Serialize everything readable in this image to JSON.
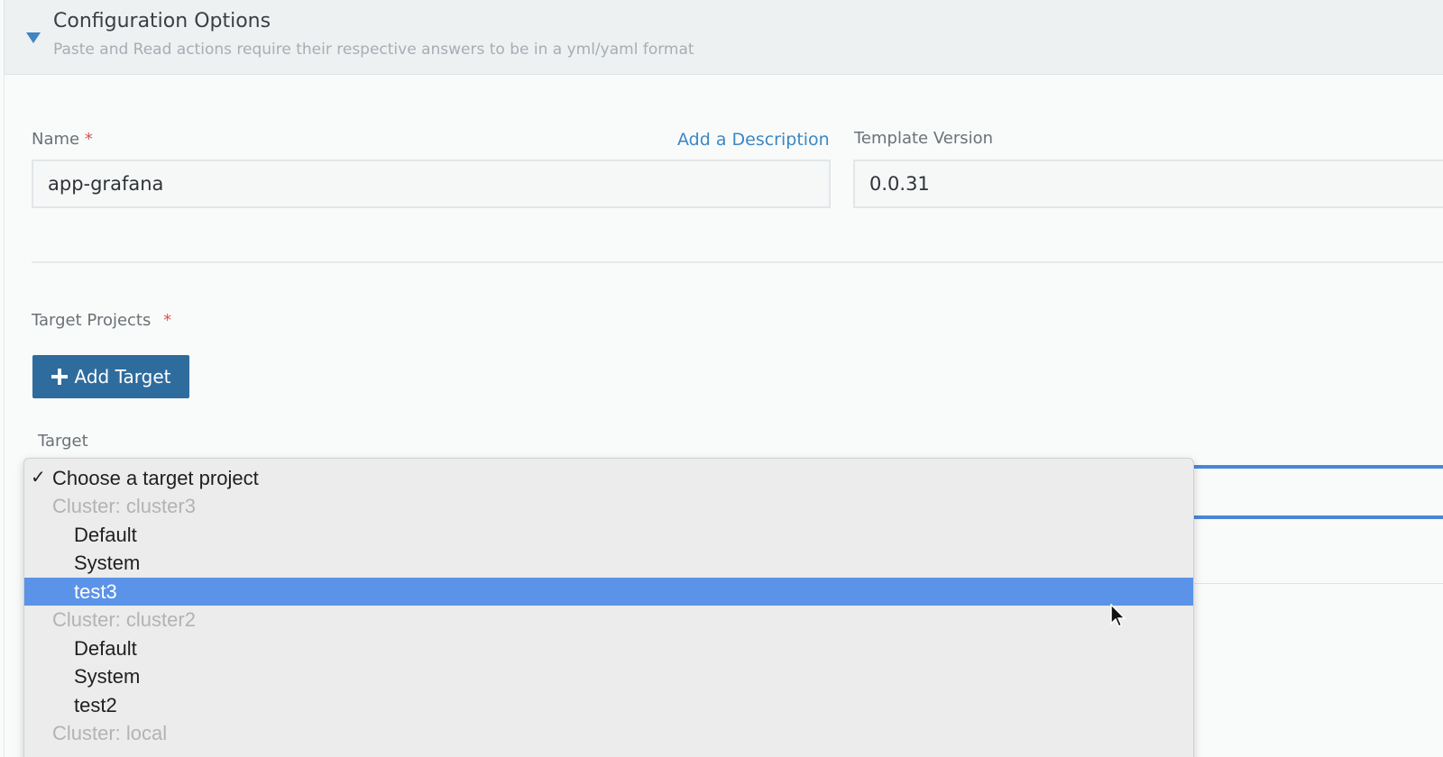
{
  "accordion": {
    "title": "Configuration Options",
    "subtitle": "Paste and Read actions require their respective answers to be in a yml/yaml format"
  },
  "form": {
    "name_label": "Name",
    "required_mark": "*",
    "add_description_link": "Add a Description",
    "name_value": "app-grafana",
    "template_version_label": "Template Version",
    "template_version_value": "0.0.31",
    "target_projects_label": "Target Projects",
    "add_target_button": "Add Target",
    "target_label": "Target"
  },
  "dropdown": {
    "check_glyph": "✓",
    "options": [
      {
        "label": "Choose a target project",
        "type": "placeholder",
        "checked": true
      },
      {
        "label": "Cluster: cluster3",
        "type": "group"
      },
      {
        "label": "Default",
        "type": "option"
      },
      {
        "label": "System",
        "type": "option"
      },
      {
        "label": "test3",
        "type": "option",
        "highlighted": true
      },
      {
        "label": "Cluster: cluster2",
        "type": "group"
      },
      {
        "label": "Default",
        "type": "option"
      },
      {
        "label": "System",
        "type": "option"
      },
      {
        "label": "test2",
        "type": "option"
      },
      {
        "label": "Cluster: local",
        "type": "group"
      }
    ]
  },
  "colors": {
    "accent": "#3d87c4",
    "button": "#2f6c9e",
    "highlight": "#5b93e8",
    "required": "#d9534f"
  }
}
